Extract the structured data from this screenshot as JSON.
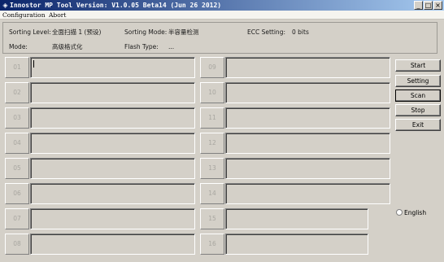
{
  "window": {
    "title": "Innostor MP Tool Version: V1.0.05 Beta14 (Jun 26 2012)",
    "controls": [
      "_",
      "□",
      "×"
    ]
  },
  "menu": [
    "Configuration",
    "Abort"
  ],
  "info": {
    "sorting_level_label": "Sorting Level:",
    "sorting_level_value": "全面扫描 1 (预设)",
    "sorting_mode_label": "Sorting Mode:",
    "sorting_mode_value": "半容量检测",
    "ecc_label": "ECC Setting:",
    "ecc_value": "0 bits",
    "mode_label": "Mode:",
    "mode_value": "高级格式化",
    "flash_type_label": "Flash Type:",
    "flash_type_value": "..."
  },
  "ports": {
    "left": [
      "01",
      "02",
      "03",
      "04",
      "05",
      "06",
      "07",
      "08"
    ],
    "right": [
      "09",
      "10",
      "11",
      "12",
      "13",
      "14",
      "15",
      "16"
    ]
  },
  "actions": [
    "Start",
    "Setting",
    "Scan",
    "Stop",
    "Exit"
  ],
  "language": {
    "label": "English",
    "selected": false
  }
}
